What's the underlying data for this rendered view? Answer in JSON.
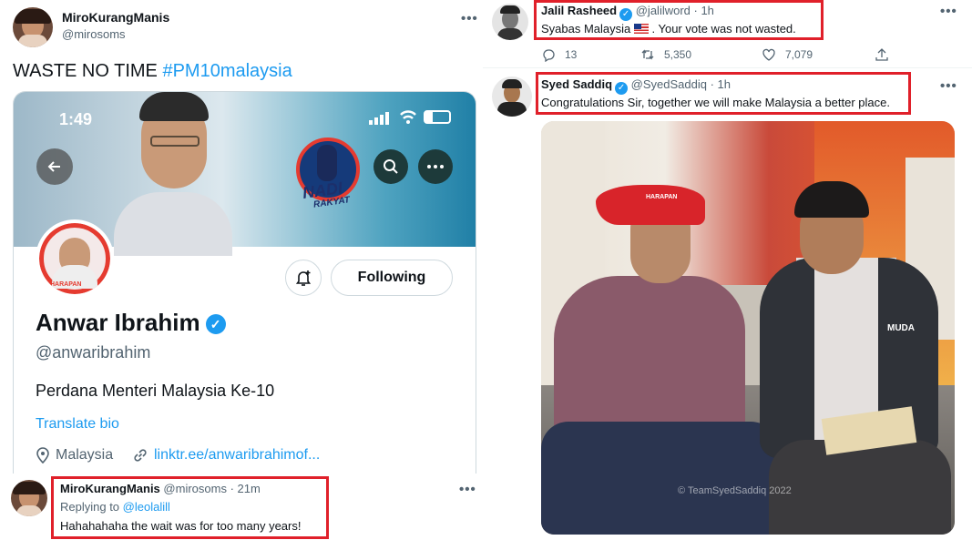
{
  "left_tweet": {
    "display_name": "MiroKurangManis",
    "handle": "@mirosoms",
    "text_prefix": "WASTE NO TIME ",
    "hashtag": "#PM10malaysia",
    "more": "•••"
  },
  "profile_card": {
    "time": "1:49",
    "banner_logo_line1": "NADI",
    "banner_logo_line2": "RAKYAT",
    "avatar_party_text": "HARAPAN",
    "following_label": "Following",
    "name": "Anwar Ibrahim",
    "handle": "@anwaribrahim",
    "bio": "Perdana Menteri Malaysia Ke-10",
    "translate": "Translate bio",
    "location": "Malaysia",
    "link": "linktr.ee/anwaribrahimof..."
  },
  "reply_tweet": {
    "display_name": "MiroKurangManis",
    "handle_time": "@mirosoms · 21m",
    "replying_prefix": "Replying to ",
    "replying_handle": "@leolalill",
    "text": "Hahahahaha the wait was for too many years!",
    "more": "•••"
  },
  "jalil_tweet": {
    "display_name": "Jalil Rasheed",
    "handle_time": "@jalilword · 1h",
    "text_before_flag": "Syabas Malaysia ",
    "text_after_flag": " . Your vote was not wasted.",
    "replies": "13",
    "retweets": "5,350",
    "likes": "7,079",
    "more": "•••"
  },
  "syed_tweet": {
    "display_name": "Syed Saddiq",
    "handle_time": "@SyedSaddiq · 1h",
    "text": "Congratulations Sir, together we will make Malaysia a better place.",
    "cap_text": "HARAPAN",
    "vest_text": "MUDA",
    "watermark": "© TeamSyedSaddiq 2022",
    "more": "•••"
  },
  "colors": {
    "accent": "#1d9bf0",
    "highlight_box": "#e0202a",
    "text": "#0f1419",
    "muted": "#536471"
  }
}
